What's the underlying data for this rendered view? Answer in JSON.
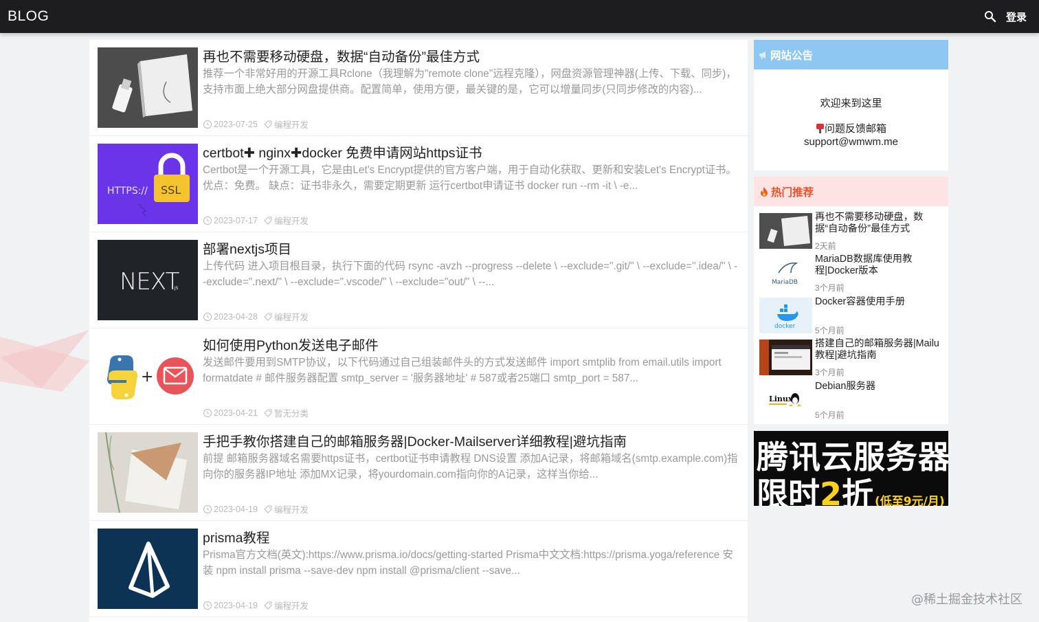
{
  "header": {
    "brand": "BLOG",
    "login_label": "登录"
  },
  "posts": [
    {
      "title": "再也不需要移动硬盘，数据“自动备份”最佳方式",
      "excerpt": "推荐一个非常好用的开源工具Rclone（我理解为\"remote clone\"远程克隆），网盘资源管理神器(上传、下载、同步)，支持市面上绝大部分网盘提供商。配置简单，使用方便，最关键的是，它可以增量同步(只同步修改的内容)...",
      "date": "2023-07-25",
      "category": "编程开发"
    },
    {
      "title": "certbot✚ nginx✚docker 免费申请网站https证书",
      "excerpt": "Certbot是一个开源工具，它是由Let's Encrypt提供的官方客户端，用于自动化获取、更新和安装Let's Encrypt证书。 优点：免费。 缺点：证书非永久，需要定期更新 运行certbot申请证书 docker run --rm -it \\ -e...",
      "date": "2023-07-17",
      "category": "编程开发",
      "thumb_text_left": "HTTPS://",
      "thumb_text_right": "SSL"
    },
    {
      "title": "部署nextjs项目",
      "excerpt": "上传代码 进入项目根目录，执行下面的代码 rsync -avzh --progress --delete \\ --exclude=\".git/\" \\ --exclude=\".idea/\" \\ --exclude=\".next/\" \\ --exclude=\".vscode/\" \\ --exclude=\"out/\" \\ --...",
      "date": "2023-04-28",
      "category": "编程开发",
      "thumb_text": "NEXT",
      "thumb_sub": ".JS"
    },
    {
      "title": "如何使用Python发送电子邮件",
      "excerpt": "发送邮件要用到SMTP协议，以下代码通过自己组装邮件头的方式发送邮件 import smtplib from email.utils import formatdate # 邮件服务器配置 smtp_server = '服务器地址' # 587或者25端口 smtp_port = 587...",
      "date": "2023-04-21",
      "category": "暂无分类",
      "thumb_plus": "+"
    },
    {
      "title": "手把手教你搭建自己的邮箱服务器|Docker-Mailserver详细教程|避坑指南",
      "excerpt": "前提 邮箱服务器域名需要https证书，certbot证书申请教程 DNS设置 添加A记录，将邮箱域名(smtp.example.com)指向你的服务器IP地址 添加MX记录，将yourdomain.com指向你的A记录，这样当你给...",
      "date": "2023-04-19",
      "category": "编程开发"
    },
    {
      "title": "prisma教程",
      "excerpt": "Prisma官方文档(英文):https://www.prisma.io/docs/getting-started Prisma中文文档:https://prisma.yoga/reference 安装 npm install prisma --save-dev npm install @prisma/client --save...",
      "date": "2023-04-19",
      "category": "编程开发"
    }
  ],
  "notice": {
    "title": "网站公告",
    "welcome": "欢迎来到这里",
    "mail_label": "问题反馈邮箱",
    "mail": "support@wmwm.me"
  },
  "hot": {
    "title": "热门推荐",
    "items": [
      {
        "title": "再也不需要移动硬盘，数据“自动备份”最佳方式",
        "time": "2天前"
      },
      {
        "title": "MariaDB数据库使用教程|Docker版本",
        "time": "3个月前",
        "thumb_text": "MariaDB"
      },
      {
        "title": "Docker容器使用手册",
        "time": "5个月前",
        "thumb_text": "docker"
      },
      {
        "title": "搭建自己的邮箱服务器|Mailu教程|避坑指南",
        "time": "3个月前"
      },
      {
        "title": "Debian服务器",
        "time": "5个月前",
        "thumb_text": "Linux"
      }
    ]
  },
  "ad": {
    "line1": "腾讯云服务器",
    "line2_a": "限时",
    "line2_num": "2",
    "line2_b": "折",
    "line2_sub": "(低至9元/月)"
  },
  "watermark": "@稀土掘金技术社区",
  "colors": {
    "topbar": "#1d1d1f",
    "notice_head": "#8ec7f1",
    "hot_head_bg": "#fde3e3",
    "hot_head_text": "#e8542c",
    "ad_accent": "#ffd21a"
  }
}
